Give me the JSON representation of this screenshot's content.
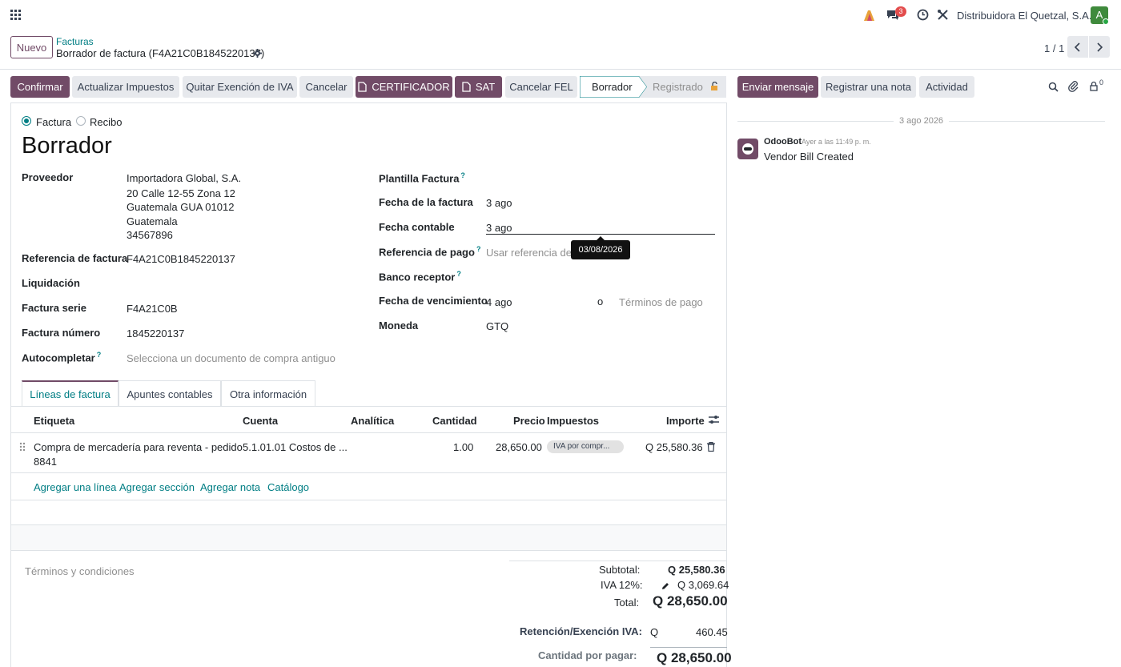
{
  "topbar": {
    "company": "Distribuidora El Quetzal, S.A.",
    "chat_count": "3",
    "avatar_letter": "A",
    "colors": {
      "avatar_bg": "#3f8a3c",
      "badge": "#e34d4d"
    }
  },
  "control": {
    "new_button": "Nuevo",
    "breadcrumb_parent": "Facturas",
    "record_title": "Borrador de factura (F4A21C0B1845220137)",
    "pager": "1 / 1"
  },
  "actions": {
    "confirm": "Confirmar",
    "update_taxes": "Actualizar Impuestos",
    "remove_exemption": "Quitar Exención de IVA",
    "cancel": "Cancelar",
    "certifier": "CERTIFICADOR",
    "sat": "SAT",
    "cancel_fel": "Cancelar FEL"
  },
  "status": {
    "draft": "Borrador",
    "posted": "Registrado"
  },
  "chatter": {
    "send_message": "Enviar mensaje",
    "log_note": "Registrar una nota",
    "activity": "Actividad",
    "followers_count": "0",
    "date_separator": "3 ago 2026",
    "messages": [
      {
        "author": "OdooBot",
        "time": "Ayer a las 11:49 p. m.",
        "body": "Vendor Bill Created"
      }
    ]
  },
  "form": {
    "type_invoice": "Factura",
    "type_receipt": "Recibo",
    "state_title": "Borrador",
    "vendor_label": "Proveedor",
    "vendor_lines": [
      "Importadora Global, S.A.",
      "20 Calle 12-55 Zona 12",
      "Guatemala GUA 01012",
      "Guatemala",
      "34567896"
    ],
    "ref_label": "Referencia de factura",
    "ref_value": "F4A21C0B1845220137",
    "liq_label": "Liquidación",
    "serie_label": "Factura serie",
    "serie_value": "F4A21C0B",
    "numero_label": "Factura número",
    "numero_value": "1845220137",
    "autocomplete_label": "Autocompletar",
    "autocomplete_placeholder": "Selecciona un documento de compra antiguo",
    "template_label": "Plantilla Factura",
    "invoice_date_label": "Fecha de la factura",
    "invoice_date_value": "3 ago",
    "accounting_date_label": "Fecha contable",
    "accounting_date_value": "3 ago",
    "tooltip_date": "03/08/2026",
    "payment_ref_label": "Referencia de pago",
    "payment_ref_placeholder": "Usar referencia de f",
    "bank_label": "Banco receptor",
    "due_date_label": "Fecha de vencimiento",
    "due_date_value": "4 ago",
    "or_text": "o",
    "payment_terms_placeholder": "Términos de pago",
    "currency_label": "Moneda",
    "currency_value": "GTQ"
  },
  "tabs": [
    "Líneas de factura",
    "Apuntes contables",
    "Otra información"
  ],
  "lines": {
    "headers": {
      "label": "Etiqueta",
      "account": "Cuenta",
      "analytic": "Analítica",
      "qty": "Cantidad",
      "price": "Precio",
      "taxes": "Impuestos",
      "amount": "Importe"
    },
    "rows": [
      {
        "label_1": "Compra de mercadería para reventa - pedido",
        "label_2": "8841",
        "account": "5.1.01.01 Costos de ...",
        "qty": "1.00",
        "price": "28,650.00",
        "tax": "IVA por compr...",
        "amount": "Q 25,580.36"
      }
    ],
    "add_line": "Agregar una línea",
    "add_section": "Agregar sección",
    "add_note": "Agregar nota",
    "catalog": "Catálogo"
  },
  "totals": {
    "terms_placeholder": "Términos y condiciones",
    "subtotal_label": "Subtotal:",
    "subtotal_value": "Q 25,580.36",
    "iva_label": "IVA 12%:",
    "iva_value": "Q 3,069.64",
    "total_label": "Total:",
    "total_value": "Q 28,650.00",
    "retention_label": "Retención/Exención IVA:",
    "retention_currency": "Q",
    "retention_value": "460.45",
    "due_label": "Cantidad por pagar:",
    "due_value": "Q 28,650.00"
  }
}
